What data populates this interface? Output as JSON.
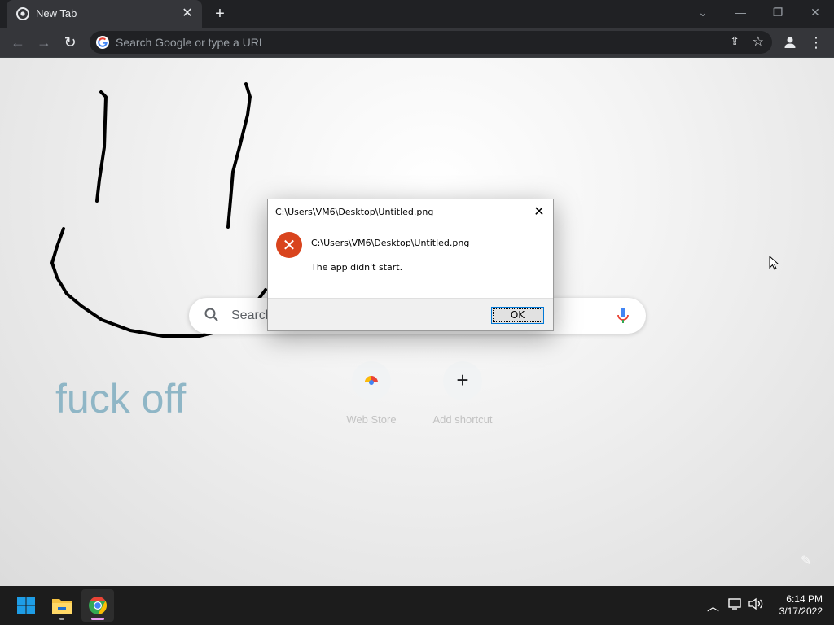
{
  "browser": {
    "tab_title": "New Tab",
    "new_tab_symbol": "+",
    "omnibox_placeholder": "Search Google or type a URL"
  },
  "page": {
    "graffiti_text": "fuck off",
    "search_placeholder": "Search",
    "shortcuts": [
      {
        "label": "Web Store",
        "icon": "chrome-web-store-icon"
      },
      {
        "label": "Add shortcut",
        "icon": "plus-icon"
      }
    ]
  },
  "dialog": {
    "title": "C:\\Users\\VM6\\Desktop\\Untitled.png",
    "path": "C:\\Users\\VM6\\Desktop\\Untitled.png",
    "message": "The app didn't start.",
    "ok_label": "OK",
    "icon": "error-icon"
  },
  "taskbar": {
    "time": "6:14 PM",
    "date": "3/17/2022",
    "apps": [
      "start",
      "file-explorer",
      "chrome"
    ]
  },
  "colors": {
    "chrome_dark": "#202124",
    "toolbar": "#35363a",
    "error_red": "#d9441d",
    "graffiti": "#8fb6c6"
  }
}
